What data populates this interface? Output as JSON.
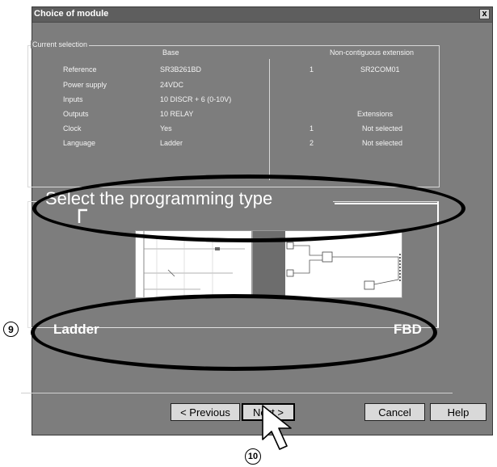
{
  "window": {
    "title": "Choice of module",
    "close_glyph": "x"
  },
  "current_selection": {
    "legend": "Current selection",
    "base_header": "Base",
    "labels": [
      "Reference",
      "Power supply",
      "Inputs",
      "Outputs",
      "Clock",
      "Language"
    ],
    "values": [
      "SR3B261BD",
      "24VDC",
      "10 DISCR + 6 (0-10V)",
      "10 RELAY",
      "Yes",
      "Ladder"
    ],
    "noncontiguous_header": "Non-contiguous extension",
    "noncontiguous": {
      "index": "1",
      "value": "SR2COM01"
    },
    "extensions_header": "Extensions",
    "extensions": [
      {
        "index": "1",
        "value": "Not selected"
      },
      {
        "index": "2",
        "value": "Not selected"
      }
    ]
  },
  "programming": {
    "title": "Select the programming type",
    "ladder_label": "Ladder",
    "fbd_label": "FBD"
  },
  "buttons": {
    "previous": "< Previous",
    "next": "Next >",
    "cancel": "Cancel",
    "help": "Help"
  },
  "callouts": {
    "nine": "9",
    "ten": "10"
  },
  "icons": {
    "cursor": "arrow-cursor-icon",
    "close": "close-icon"
  }
}
